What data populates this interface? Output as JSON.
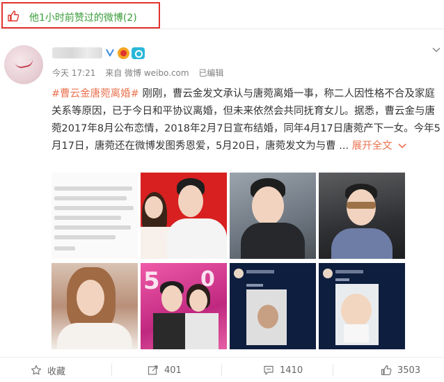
{
  "liked_header": {
    "text": "他1小时前赞过的微博(2)",
    "icon": "thumbs-up-icon",
    "text_color": "#3a9d3a",
    "highlight_color": "#e0332e"
  },
  "post": {
    "meta": {
      "time": "今天 17:21",
      "source": "来自 微博 weibo.com",
      "edited": "已编辑"
    },
    "hashtag": "#曹云金唐菀离婚#",
    "body": " 刚刚，曹云金发文承认与唐菀离婚一事，称二人因性格不合及家庭关系等原因，已于今日和平协议离婚，但未来依然会共同抚育女儿。据悉，曹云金与唐菀2017年8月公布恋情，2018年2月7日宣布结婚，同年4月17日唐菀产下一女。今年5月17日，唐菀还在微博发图秀恩爱，5月20日，唐菀发文为与曹 ...",
    "expand_label": "展开全文",
    "expand_icon": "chevron-down-icon",
    "link_color": "#eb7350"
  },
  "images": [
    {
      "name": "statement-screenshot"
    },
    {
      "name": "couple-red-photo"
    },
    {
      "name": "selfie-man"
    },
    {
      "name": "man-sunglasses-car"
    },
    {
      "name": "woman-selfie"
    },
    {
      "name": "520-poster"
    },
    {
      "name": "weibo-post-screenshot-1"
    },
    {
      "name": "weibo-post-screenshot-2"
    }
  ],
  "actions": {
    "favorite": {
      "label": "收藏",
      "icon": "star-icon"
    },
    "repost": {
      "label": "401",
      "icon": "repost-icon"
    },
    "comment": {
      "label": "1410",
      "icon": "comment-icon"
    },
    "like": {
      "label": "3503",
      "icon": "thumbs-up-icon"
    }
  }
}
